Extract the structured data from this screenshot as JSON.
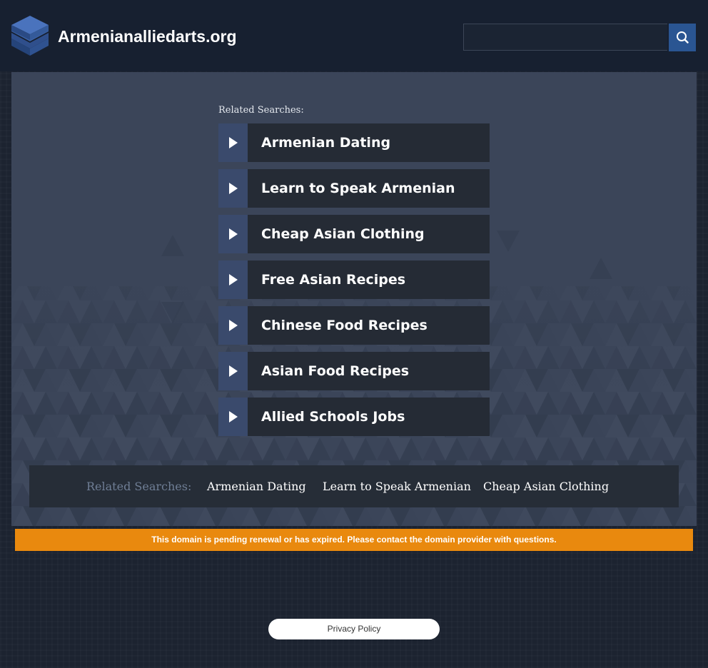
{
  "header": {
    "site_title": "Armenianalliedarts.org",
    "logo_icon": "stacked-layers-icon",
    "search": {
      "value": "",
      "placeholder": "",
      "button_icon": "search-icon"
    }
  },
  "main": {
    "related_heading": "Related Searches:",
    "links": [
      {
        "label": "Armenian Dating"
      },
      {
        "label": "Learn to Speak Armenian"
      },
      {
        "label": "Cheap Asian Clothing"
      },
      {
        "label": "Free Asian Recipes"
      },
      {
        "label": "Chinese Food Recipes"
      },
      {
        "label": "Asian Food Recipes"
      },
      {
        "label": "Allied Schools Jobs"
      }
    ],
    "link_icon": "play-arrow-icon"
  },
  "bottom_bar": {
    "heading": "Related Searches:",
    "links": [
      {
        "label": "Armenian Dating"
      },
      {
        "label": "Learn to Speak Armenian"
      },
      {
        "label": "Cheap Asian Clothing"
      }
    ]
  },
  "notice": {
    "text": "This domain is pending renewal or has expired. Please contact the domain provider with questions."
  },
  "footer": {
    "privacy_label": "Privacy Policy"
  },
  "colors": {
    "header_bg": "#172030",
    "panel_bg": "#3b4559",
    "link_bg": "#252b35",
    "arrow_bg": "#3a4a6c",
    "search_button": "#2a5592",
    "notice_bg": "#e9890e",
    "page_bg": "#1c2330"
  }
}
